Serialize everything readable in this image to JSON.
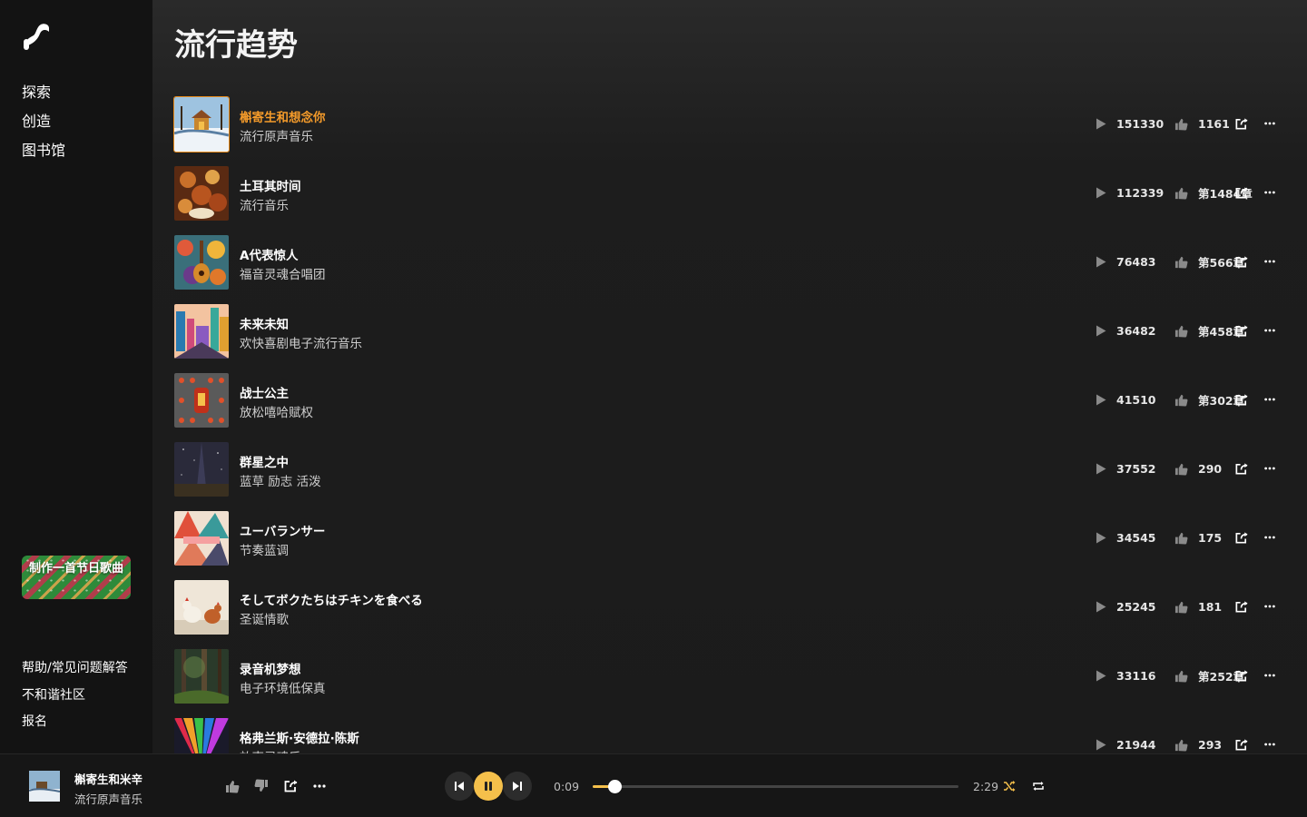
{
  "app": {
    "nav": [
      {
        "label": "探索"
      },
      {
        "label": "创造"
      },
      {
        "label": "图书馆"
      }
    ],
    "promo_label": "制作一首节日歌曲",
    "footer_links": [
      {
        "label": "帮助/常见问题解答"
      },
      {
        "label": "不和谐社区"
      },
      {
        "label": "报名"
      }
    ]
  },
  "page": {
    "title": "流行趋势"
  },
  "songs": [
    {
      "title": "槲寄生和想念你",
      "subtitle": "流行原声音乐",
      "plays": "151330",
      "likes": "1161",
      "active": true,
      "art": "winter"
    },
    {
      "title": "土耳其时间",
      "subtitle": "流行音乐",
      "plays": "112339",
      "likes": "第1484章",
      "art": "feast"
    },
    {
      "title": "A代表惊人",
      "subtitle": "福音灵魂合唱团",
      "plays": "76483",
      "likes": "第566章",
      "art": "guitar"
    },
    {
      "title": "未来未知",
      "subtitle": "欢快喜剧电子流行音乐",
      "plays": "36482",
      "likes": "第458章",
      "art": "city"
    },
    {
      "title": "战士公主",
      "subtitle": "放松嘻哈赋权",
      "plays": "41510",
      "likes": "第302章",
      "art": "lanterns"
    },
    {
      "title": "群星之中",
      "subtitle": "蓝草 励志 活泼",
      "plays": "37552",
      "likes": "290",
      "art": "stars"
    },
    {
      "title": "ユーバランサー",
      "subtitle": "节奏蓝调",
      "plays": "34545",
      "likes": "175",
      "art": "geometric"
    },
    {
      "title": "そしてボクたちはチキンを食べる",
      "subtitle": "圣诞情歌",
      "plays": "25245",
      "likes": "181",
      "art": "chickens"
    },
    {
      "title": "录音机梦想",
      "subtitle": "电子环境低保真",
      "plays": "33116",
      "likes": "第252章",
      "art": "forest"
    },
    {
      "title": "格弗兰斯·安德拉·陈斯",
      "subtitle": "放克灵魂乐",
      "plays": "21944",
      "likes": "293",
      "art": "rainbow"
    }
  ],
  "player": {
    "title": "槲寄生和米辛",
    "subtitle": "流行原声音乐",
    "current_time": "0:09",
    "total_time": "2:29",
    "progress": 0.06
  },
  "colors": {
    "accent": "#f5c04b",
    "active_title": "#f39a2a"
  },
  "icons": [
    "logo-icon",
    "play-icon",
    "thumbs-up-icon",
    "share-icon",
    "more-icon",
    "thumbs-down-icon",
    "previous-icon",
    "pause-icon",
    "next-icon",
    "shuffle-icon",
    "repeat-icon"
  ]
}
